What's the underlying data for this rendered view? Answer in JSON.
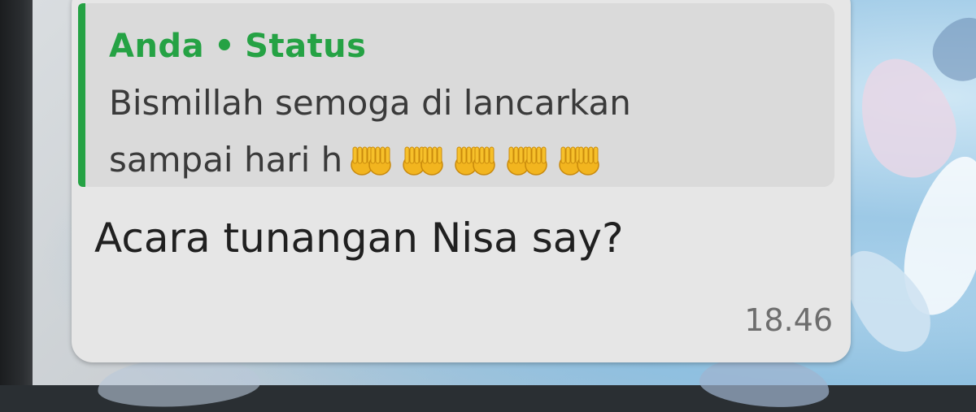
{
  "reply_quote": {
    "author": "Anda",
    "separator": "•",
    "type": "Status",
    "line1": "Bismillah semoga di lancarkan",
    "line2": "sampai hari h",
    "emoji": [
      "palms-up-together",
      "palms-up-together",
      "palms-up-together",
      "palms-up-together",
      "palms-up-together"
    ],
    "accent_color": "#25a244"
  },
  "message": {
    "text": "Acara tunangan Nisa say?",
    "time": "18.46"
  }
}
